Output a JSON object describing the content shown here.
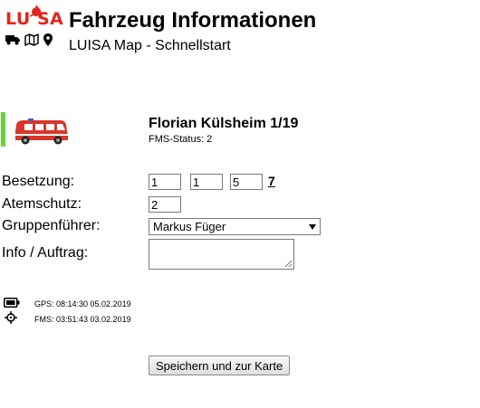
{
  "header": {
    "logo_text": "LU SA",
    "title": "Fahrzeug Informationen",
    "subtitle": "LUISA Map - Schnellstart",
    "nav_icons": [
      "truck-icon",
      "map-icon",
      "map-pin-icon"
    ]
  },
  "vehicle": {
    "name": "Florian Külsheim 1/19",
    "fms_status": "FMS-Status: 2",
    "status_color": "#66d23c",
    "icon": "fire-van-icon",
    "icon_color": "#d9362a"
  },
  "form": {
    "crew_label": "Besetzung:",
    "crew_values": [
      "1",
      "1",
      "5"
    ],
    "crew_total": "7",
    "respiratory_label": "Atemschutz:",
    "respiratory_value": "2",
    "leader_label": "Gruppenführer:",
    "leader_selected": "Markus Füger",
    "info_label": "Info / Auftrag:",
    "info_value": ""
  },
  "status": {
    "gps": "GPS: 08:14:30 05.02.2019",
    "fms": "FMS: 03:51:43 03.02.2019",
    "gps_icon": "battery-icon",
    "fms_icon": "crosshair-icon"
  },
  "actions": {
    "save_label": "Speichern und zur Karte"
  },
  "colors": {
    "brand_red": "#e1261c"
  }
}
